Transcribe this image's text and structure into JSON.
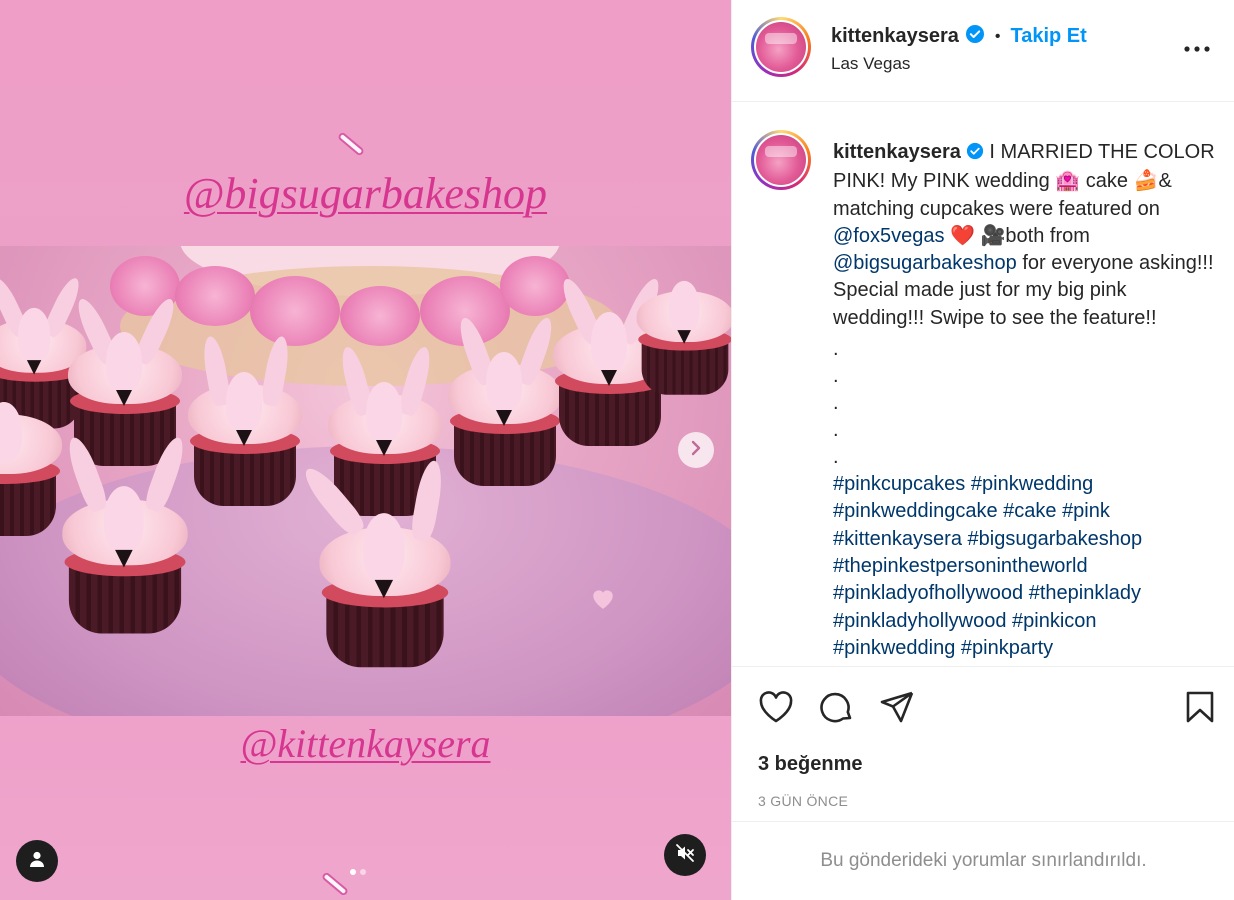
{
  "media": {
    "overlay_top": "@bigsugarbakeshop",
    "overlay_bottom": "@kittenkaysera",
    "carousel_dots": 2,
    "active_dot": 1
  },
  "header": {
    "username": "kittenkaysera",
    "separator": "•",
    "follow_label": "Takip Et",
    "location": "Las Vegas"
  },
  "caption": {
    "username": "kittenkaysera",
    "text_1": " I MARRIED THE COLOR PINK! My PINK wedding ",
    "emoji_1": "🏩",
    "text_2": " cake ",
    "emoji_2": "🍰",
    "text_3": "& matching cupcakes were featured on ",
    "mention_1": "@fox5vegas",
    "emoji_3": " ❤️ 🎥",
    "text_4": "both from ",
    "mention_2": "@bigsugarbakeshop",
    "text_5": " for everyone asking!!! Special made just for my big pink wedding!!! Swipe to see the feature!!",
    "dots": [
      ".",
      ".",
      ".",
      ".",
      "."
    ],
    "hashtags": [
      "#pinkcupcakes",
      "#pinkwedding",
      "#pinkweddingcake",
      "#cake",
      "#pink",
      "#kittenkaysera",
      "#bigsugarbakeshop",
      "#thepinkestpersonintheworld",
      "#pinkladyofhollywood",
      "#thepinklady",
      "#pinkladyhollywood",
      "#pinkicon",
      "#pinkwedding",
      "#pinkparty"
    ]
  },
  "stats": {
    "likes": "3 beğenme",
    "time_ago": "3 GÜN ÖNCE"
  },
  "comments_notice": "Bu gönderideki yorumlar sınırlandırıldı.",
  "colors": {
    "link": "#00376b",
    "follow": "#0095f6",
    "overlay_text": "#d6368f",
    "verified": "#0095f6"
  },
  "icons": [
    "chevron-right-icon",
    "user-tag-icon",
    "muted-speaker-icon",
    "verified-badge-icon",
    "more-icon",
    "heart-icon",
    "comment-icon",
    "share-icon",
    "bookmark-icon"
  ]
}
